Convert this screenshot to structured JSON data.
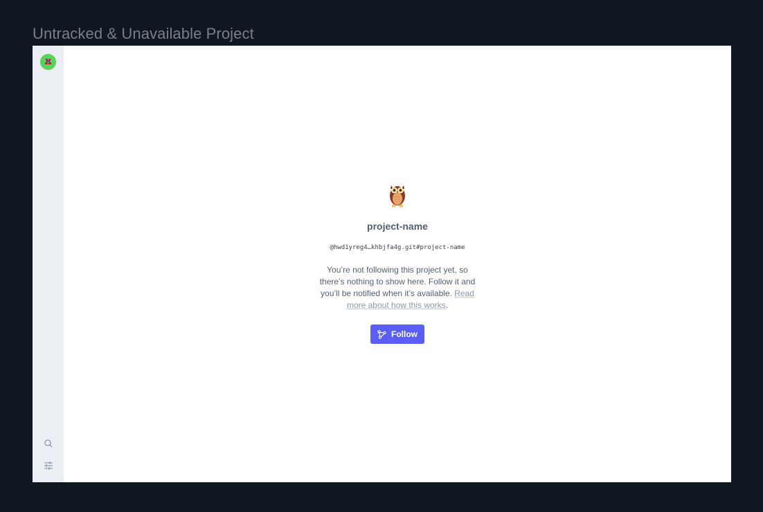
{
  "frame": {
    "title": "Untracked & Unavailable Project"
  },
  "sidebar": {
    "avatar_icon": "identicon-avatar",
    "items": [
      {
        "icon": "search-icon"
      },
      {
        "icon": "settings-sliders-icon"
      }
    ]
  },
  "project": {
    "icon": "owl-icon",
    "name": "project-name",
    "path": "@hwd1yreg4…khbjfa4g.git#project-name"
  },
  "message": {
    "body": "You’re not following this project yet, so there’s nothing to show here. Follow it and you’ll be notified when it’s available.",
    "link_label": "Read more about how this works",
    "trailing": "."
  },
  "actions": {
    "follow_label": "Follow",
    "follow_icon": "network-follow-icon"
  },
  "colors": {
    "background": "#0f1720",
    "sidebar": "#ebeef2",
    "accent": "#5b5ef4",
    "avatar": "#5ad15a"
  }
}
